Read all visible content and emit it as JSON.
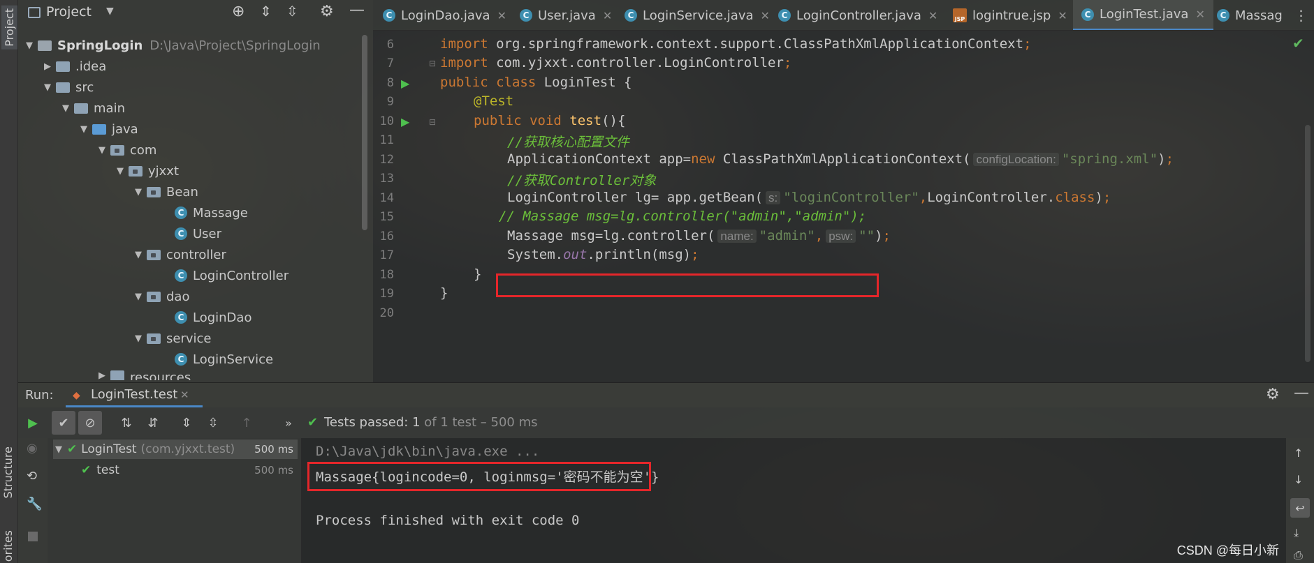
{
  "sidebar": {
    "project_label": "Project",
    "structure_label": "Structure",
    "favorites_label": "orites"
  },
  "project_panel": {
    "title": "Project",
    "tree": [
      {
        "label": "SpringLogin",
        "extra": "D:\\Java\\Project\\SpringLogin"
      },
      {
        "label": ".idea"
      },
      {
        "label": "src"
      },
      {
        "label": "main"
      },
      {
        "label": "java"
      },
      {
        "label": "com"
      },
      {
        "label": "yjxxt"
      },
      {
        "label": "Bean"
      },
      {
        "label": "Massage"
      },
      {
        "label": "User"
      },
      {
        "label": "controller"
      },
      {
        "label": "LoginController"
      },
      {
        "label": "dao"
      },
      {
        "label": "LoginDao"
      },
      {
        "label": "service"
      },
      {
        "label": "LoginService"
      },
      {
        "label": "resources"
      }
    ]
  },
  "tabs": [
    {
      "label": "LoginDao.java"
    },
    {
      "label": "User.java"
    },
    {
      "label": "LoginService.java"
    },
    {
      "label": "LoginController.java"
    },
    {
      "label": "logintrue.jsp"
    },
    {
      "label": "LoginTest.java"
    },
    {
      "label": "Massag"
    }
  ],
  "editor": {
    "line_numbers": [
      "6",
      "7",
      "8",
      "9",
      "10",
      "11",
      "12",
      "13",
      "14",
      "15",
      "16",
      "17",
      "18",
      "19",
      "20"
    ],
    "hints": {
      "config_location": "configLocation:",
      "s": "s:",
      "name": "name:",
      "psw": "psw:"
    }
  },
  "run": {
    "label": "Run:",
    "tab": "LoginTest.test",
    "status_passed": "Tests passed:",
    "status_count": "1",
    "status_detail": "of 1 test – 500 ms",
    "tree": [
      {
        "label": "LoginTest",
        "pkg": "(com.yjxxt.test)",
        "time": "500 ms"
      },
      {
        "label": "test",
        "time": "500 ms"
      }
    ],
    "console": [
      "D:\\Java\\jdk\\bin\\java.exe ...",
      "Massage{logincode=0, loginmsg='密码不能为空'}",
      "",
      "Process finished with exit code 0"
    ]
  },
  "watermark": "CSDN @每日小新",
  "colors": {
    "keyword": "#cc7832",
    "string": "#6a8759",
    "highlight_box": "#e5262a",
    "accent_tab": "#4a88c7"
  }
}
